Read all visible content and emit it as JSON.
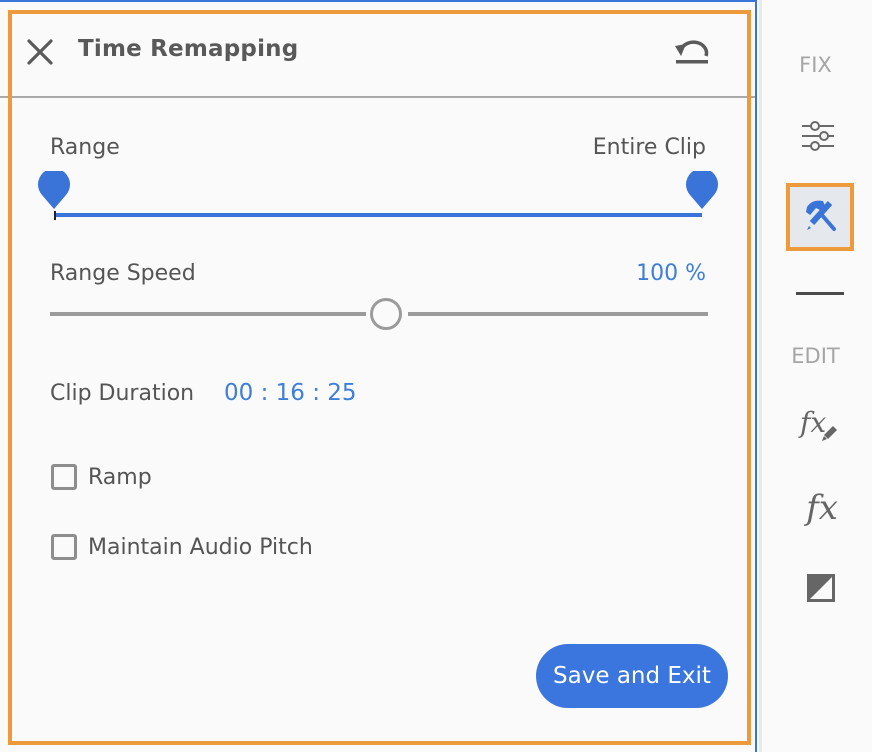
{
  "panel": {
    "title": "Time Remapping",
    "icons": {
      "close": "close-icon",
      "reset": "reset-icon"
    }
  },
  "range": {
    "label": "Range",
    "value_label": "Entire Clip",
    "start_fraction": 0.0,
    "end_fraction": 1.0
  },
  "speed": {
    "label": "Range Speed",
    "value_label": "100 %",
    "slider_fraction": 0.51
  },
  "duration": {
    "label": "Clip Duration",
    "value": "00 : 16 : 25"
  },
  "options": [
    {
      "label": "Ramp",
      "checked": false
    },
    {
      "label": "Maintain Audio Pitch",
      "checked": false
    }
  ],
  "actions": {
    "save_label": "Save and Exit"
  },
  "sidebar": {
    "fix_label": "FIX",
    "edit_label": "EDIT",
    "items": [
      {
        "name": "adjustments",
        "icon": "sliders-icon",
        "active": false
      },
      {
        "name": "guided-tools",
        "icon": "hammer-pencil-icon",
        "active": true
      },
      {
        "name": "effects-edit",
        "icon": "fx-pencil-icon",
        "label": "fx",
        "active": false
      },
      {
        "name": "effects",
        "icon": "fx-icon",
        "label": "fx",
        "active": false
      },
      {
        "name": "color-contrast",
        "icon": "contrast-icon",
        "active": false
      }
    ]
  },
  "colors": {
    "accent_blue": "#3b75de",
    "highlight_orange": "#ec9a3c",
    "value_blue": "#3d7ed8"
  }
}
